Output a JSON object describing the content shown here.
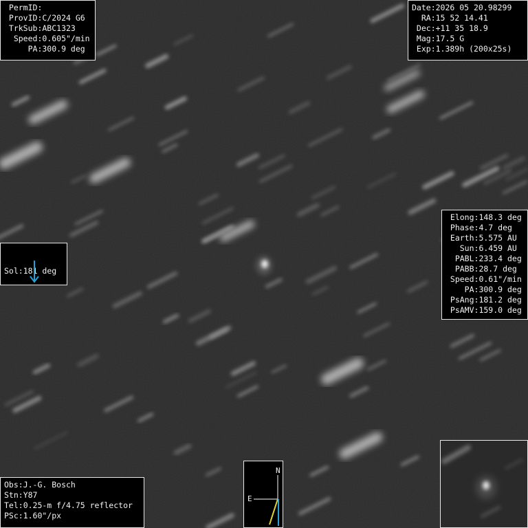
{
  "top_left_info": {
    "rows": [
      {
        "label": "PermID",
        "value": ""
      },
      {
        "label": "ProvID",
        "value": "C/2024 G6"
      },
      {
        "label": "TrkSub",
        "value": "ABC1323"
      },
      {
        "label": "Speed",
        "value": "0.605\"/min"
      },
      {
        "label": "PA",
        "value": "300.9 deg"
      }
    ]
  },
  "top_right_info": {
    "rows": [
      {
        "label": "Date",
        "value": "2026 05 20.98299"
      },
      {
        "label": "RA",
        "value": "15 52 14.41"
      },
      {
        "label": "Dec",
        "value": "+11 35 18.9"
      },
      {
        "label": "Mag",
        "value": "17.5 G"
      },
      {
        "label": "Exp",
        "value": "1.389h (200x25s)"
      }
    ]
  },
  "sol_panel": {
    "label": "Sol",
    "value": "181 deg",
    "arrow_icon": "down-arrow-icon",
    "arrow_color": "#2a9fd6"
  },
  "right_info": {
    "rows": [
      {
        "label": "Elong",
        "value": "148.3 deg"
      },
      {
        "label": "Phase",
        "value": "4.7 deg"
      },
      {
        "label": "Earth",
        "value": "5.575 AU"
      },
      {
        "label": "Sun",
        "value": "6.459 AU"
      },
      {
        "label": "PABL",
        "value": "233.4 deg"
      },
      {
        "label": "PABB",
        "value": "28.7 deg"
      },
      {
        "label": "Speed",
        "value": "0.61\"/min"
      },
      {
        "label": "PA",
        "value": "300.9 deg"
      },
      {
        "label": "PsAng",
        "value": "181.2 deg"
      },
      {
        "label": "PsAMV",
        "value": "159.0 deg"
      }
    ]
  },
  "bottom_left_info": {
    "rows": [
      {
        "label": "Obs",
        "value": "J.-G. Bosch"
      },
      {
        "label": "Stn",
        "value": "Y87"
      },
      {
        "label": "Tel",
        "value": "0.25-m f/4.75 reflector"
      },
      {
        "label": "PSc",
        "value": "1.60\"/px"
      }
    ]
  },
  "compass": {
    "north_label": "N",
    "east_label": "E",
    "motion_vector_color": "#e8d23a",
    "sun_vector_color": "#2a9fd6"
  },
  "colors": {
    "background": "#2b2b2b",
    "panel_background": "#000000",
    "panel_border": "#e8e8e8",
    "text": "#f2f2f2"
  }
}
